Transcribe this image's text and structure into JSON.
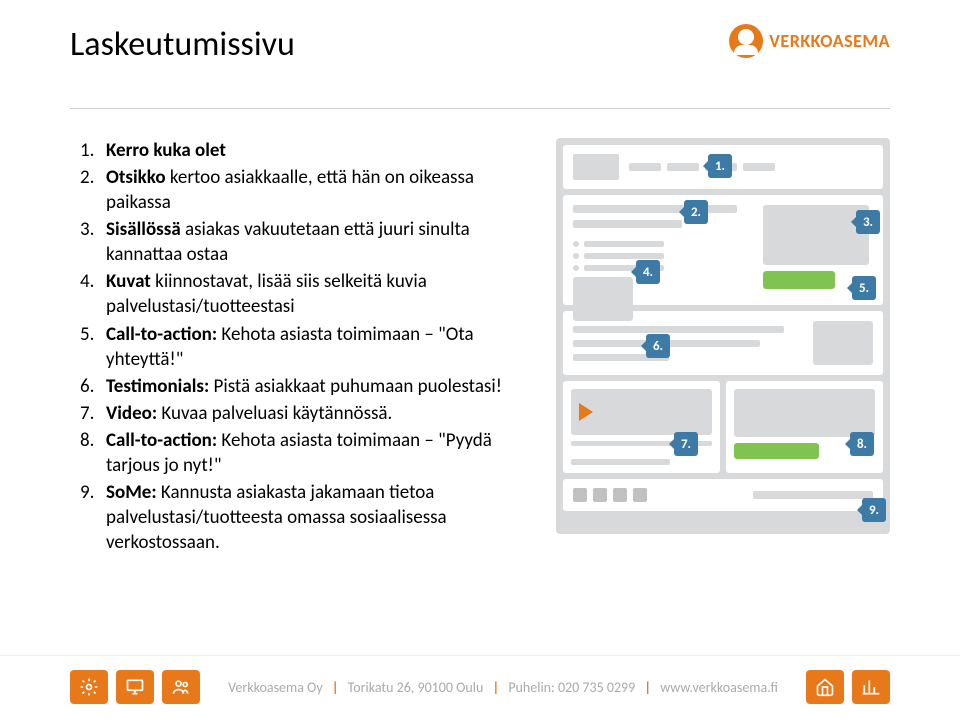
{
  "header": {
    "title": "Laskeutumissivu",
    "brand": "VERKKOASEMA"
  },
  "list": [
    {
      "bold": "Kerro kuka olet",
      "rest": ""
    },
    {
      "bold": "Otsikko",
      "rest": " kertoo asiakkaalle, että hän on oikeassa paikassa"
    },
    {
      "bold": "Sisällössä",
      "rest": " asiakas vakuutetaan että juuri sinulta kannattaa ostaa"
    },
    {
      "bold": "Kuvat",
      "rest": " kiinnostavat, lisää siis selkeitä kuvia palvelustasi/tuotteestasi"
    },
    {
      "bold": "Call-to-action:",
      "rest": " Kehota asiasta toimimaan – \"Ota yhteyttä!\""
    },
    {
      "bold": "Testimonials:",
      "rest": " Pistä asiakkaat puhumaan puolestasi!"
    },
    {
      "bold": "Video:",
      "rest": " Kuvaa palveluasi käytännössä."
    },
    {
      "bold": "Call-to-action:",
      "rest": " Kehota asiasta toimimaan – \"Pyydä tarjous jo nyt!\""
    },
    {
      "bold": "SoMe:",
      "rest": " Kannusta asiakasta jakamaan tietoa palvelustasi/tuotteesta omassa sosiaalisessa verkostossaan."
    }
  ],
  "badges": [
    "1.",
    "2.",
    "3.",
    "4.",
    "5.",
    "6.",
    "7.",
    "8.",
    "9."
  ],
  "footer": {
    "company": "Verkkoasema Oy",
    "address": "Torikatu 26, 90100 Oulu",
    "phone_label": "Puhelin:",
    "phone": "020 735 0299",
    "url": "www.verkkoasema.fi"
  }
}
